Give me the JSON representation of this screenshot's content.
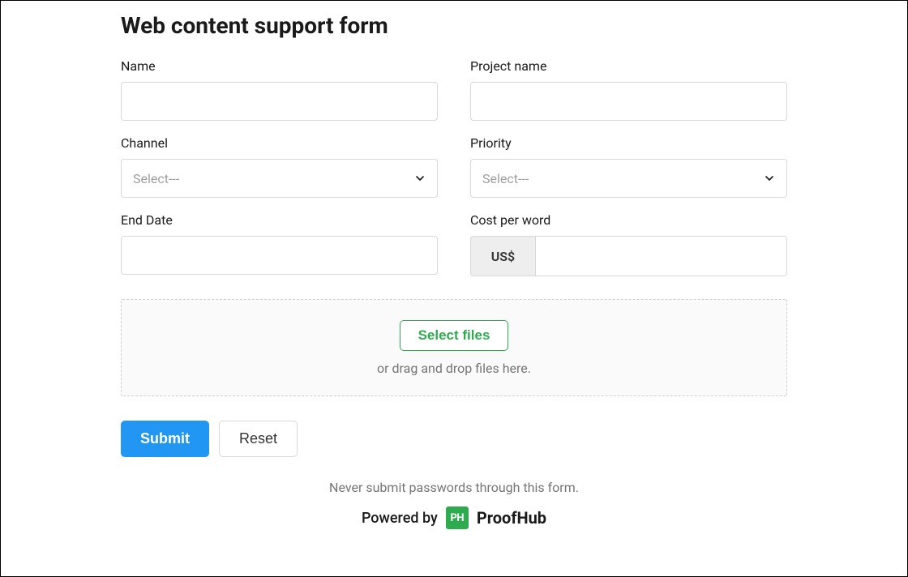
{
  "form": {
    "title": "Web content support form",
    "fields": {
      "name": {
        "label": "Name",
        "value": ""
      },
      "project_name": {
        "label": "Project name",
        "value": ""
      },
      "channel": {
        "label": "Channel",
        "placeholder": "Select---"
      },
      "priority": {
        "label": "Priority",
        "placeholder": "Select---"
      },
      "end_date": {
        "label": "End Date",
        "value": ""
      },
      "cost_per_word": {
        "label": "Cost per word",
        "prefix": "US$",
        "value": ""
      }
    },
    "upload": {
      "button_label": "Select files",
      "hint": "or drag and drop files here."
    },
    "actions": {
      "submit": "Submit",
      "reset": "Reset"
    }
  },
  "footer": {
    "warning": "Never submit passwords through this form.",
    "powered_by_prefix": "Powered by",
    "brand_logo_text": "PH",
    "brand_name": "ProofHub"
  }
}
